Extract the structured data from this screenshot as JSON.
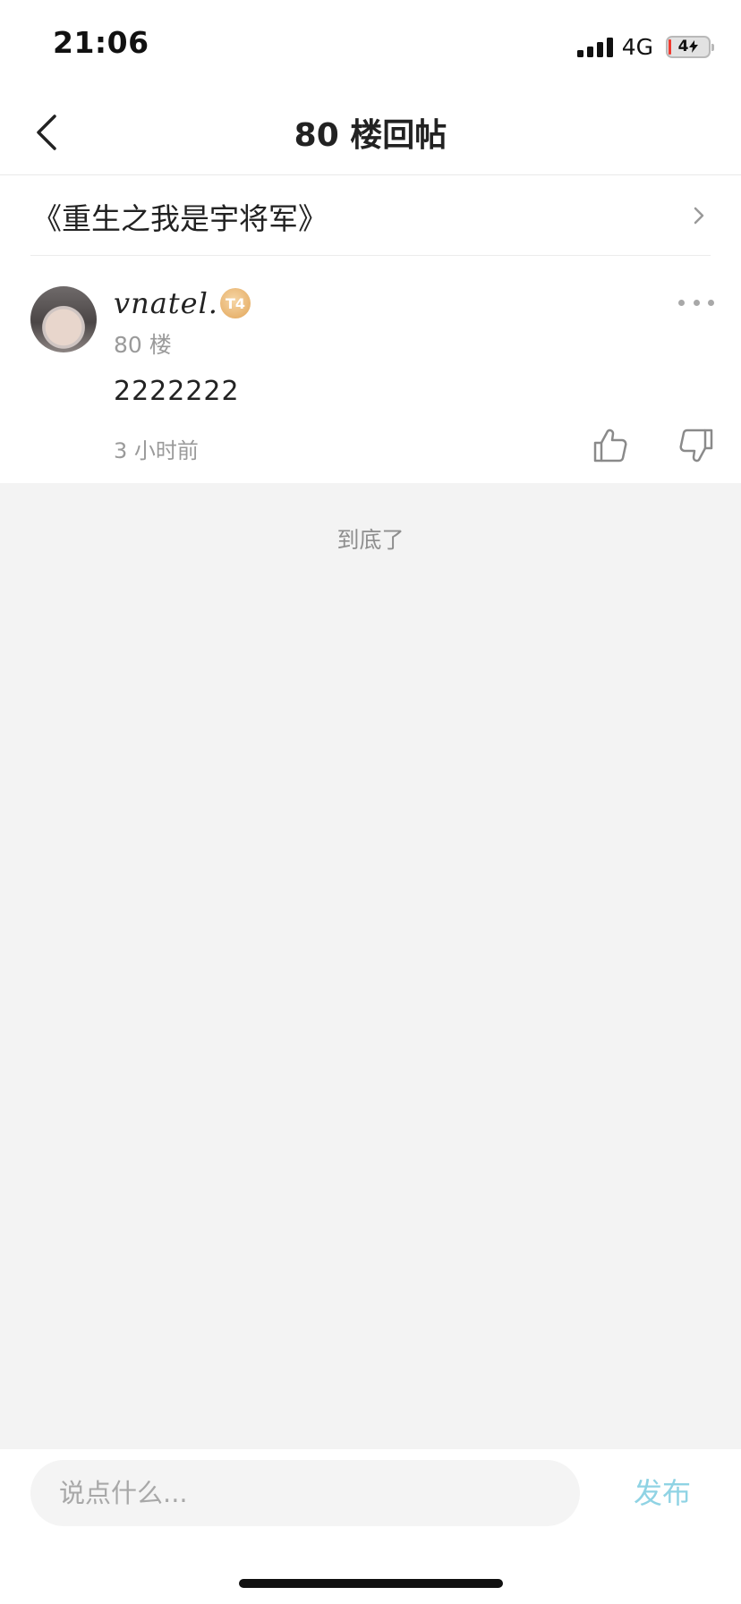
{
  "status_bar": {
    "time": "21:06",
    "network": "4G",
    "battery_level": "4"
  },
  "nav": {
    "title": "80 楼回帖",
    "back_icon": "chevron-left-icon"
  },
  "book": {
    "title": "《重生之我是宇将军》",
    "chevron_icon": "chevron-right-icon"
  },
  "reply": {
    "user_name": "vnatel.",
    "level_badge": "T4",
    "floor": "80 楼",
    "content": "2222222",
    "time": "3 小时前",
    "more_icon": "more-dots-icon",
    "like_icon": "thumbs-up-icon",
    "dislike_icon": "thumbs-down-icon"
  },
  "end_marker": "到底了",
  "composer": {
    "placeholder": "说点什么...",
    "value": "",
    "publish_label": "发布",
    "publish_color": "#8fd3e4"
  },
  "colors": {
    "background": "#f3f3f3",
    "secondary_text": "#9a9a9a",
    "badge": "#e8b470"
  }
}
